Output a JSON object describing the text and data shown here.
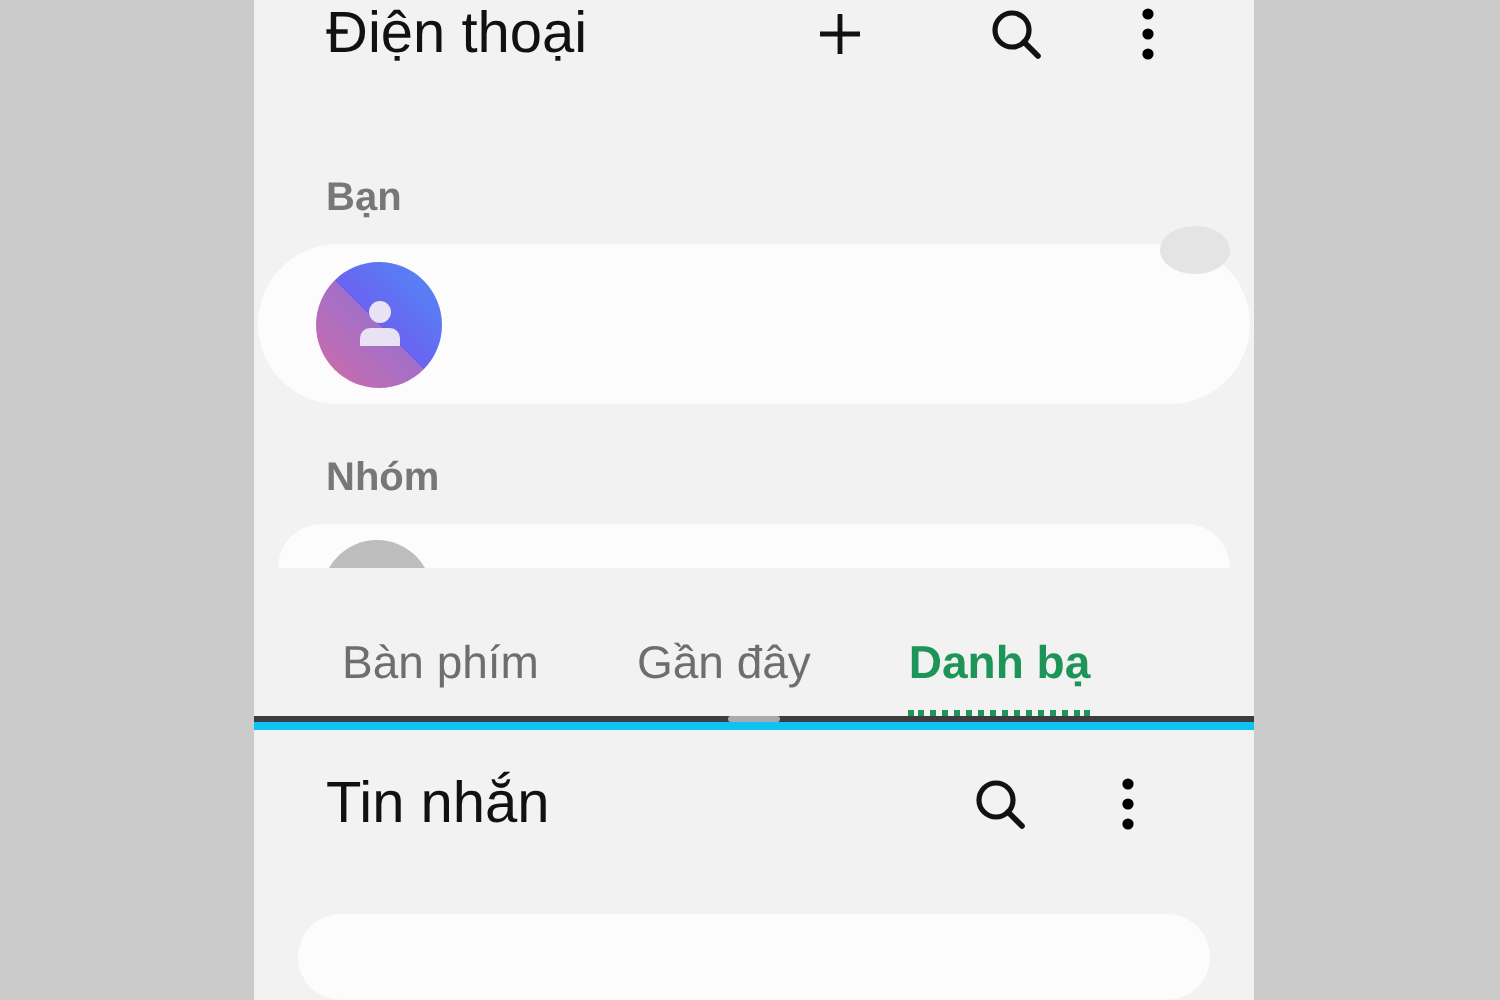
{
  "top_app": {
    "title": "Điện thoại"
  },
  "sections": [
    {
      "label": "Bạn",
      "kind": "profile"
    },
    {
      "label": "Nhóm",
      "kind": "group"
    }
  ],
  "tabs": [
    {
      "label": "Bàn phím",
      "selected": false
    },
    {
      "label": "Gần đây",
      "selected": false
    },
    {
      "label": "Danh bạ",
      "selected": true
    }
  ],
  "bottom_app": {
    "title": "Tin nhắn"
  }
}
